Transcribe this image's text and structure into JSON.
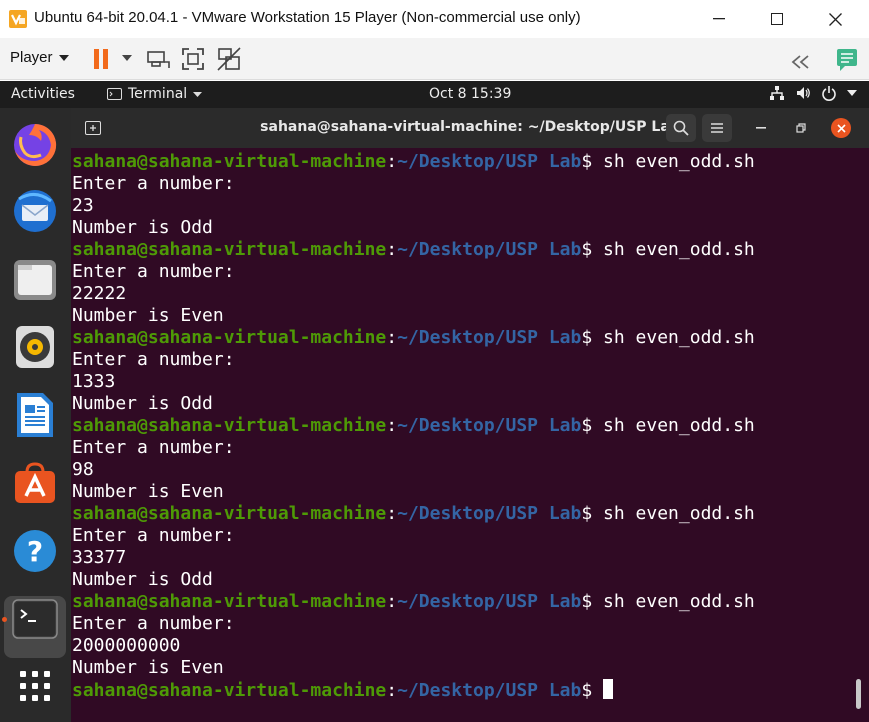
{
  "vm": {
    "title": "Ubuntu 64-bit 20.04.1 - VMware Workstation 15 Player (Non-commercial use only)",
    "player_label": "Player",
    "accent": "#f5a623"
  },
  "topbar": {
    "activities": "Activities",
    "app_name": "Terminal",
    "clock": "Oct 8  15:39"
  },
  "dock": {
    "items": [
      "firefox-icon",
      "thunderbird-icon",
      "files-icon",
      "rhythmbox-icon",
      "libreoffice-writer-icon",
      "ubuntu-software-icon",
      "help-icon",
      "terminal-icon",
      "show-applications-icon"
    ]
  },
  "terminal": {
    "title": "sahana@sahana-virtual-machine: ~/Desktop/USP Lab",
    "background": "#300a24",
    "user_host": "sahana@sahana-virtual-machine",
    "path": "~/Desktop/USP Lab",
    "command": " sh even_odd.sh",
    "prompt_text": "Enter a number:",
    "runs": [
      {
        "input": "23",
        "result": "Number is Odd"
      },
      {
        "input": "22222",
        "result": "Number is Even"
      },
      {
        "input": "1333",
        "result": "Number is Odd"
      },
      {
        "input": "98",
        "result": "Number is Even"
      },
      {
        "input": "33377",
        "result": "Number is Odd"
      },
      {
        "input": "2000000000",
        "result": "Number is Even"
      }
    ]
  }
}
